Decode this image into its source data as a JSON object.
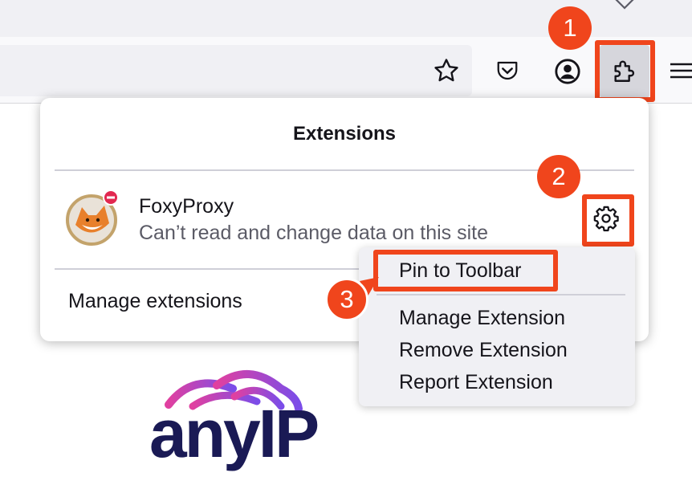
{
  "panel": {
    "title": "Extensions",
    "extension": {
      "name": "FoxyProxy",
      "description": "Can’t read and change data on this site"
    },
    "manage_label": "Manage extensions"
  },
  "context_menu": {
    "items": [
      "Pin to Toolbar",
      "Manage Extension",
      "Remove Extension",
      "Report Extension"
    ]
  },
  "steps": [
    "1",
    "2",
    "3"
  ],
  "toolbar_icons": [
    "star-icon",
    "pocket-icon",
    "account-icon",
    "puzzle-icon",
    "hamburger-menu-icon"
  ],
  "logo": {
    "text": "anyIP"
  },
  "colors": {
    "highlight": "#f0451c",
    "logo_text": "#1a1a55",
    "logo_gradient": [
      "#7b4de8",
      "#e040a0"
    ]
  }
}
